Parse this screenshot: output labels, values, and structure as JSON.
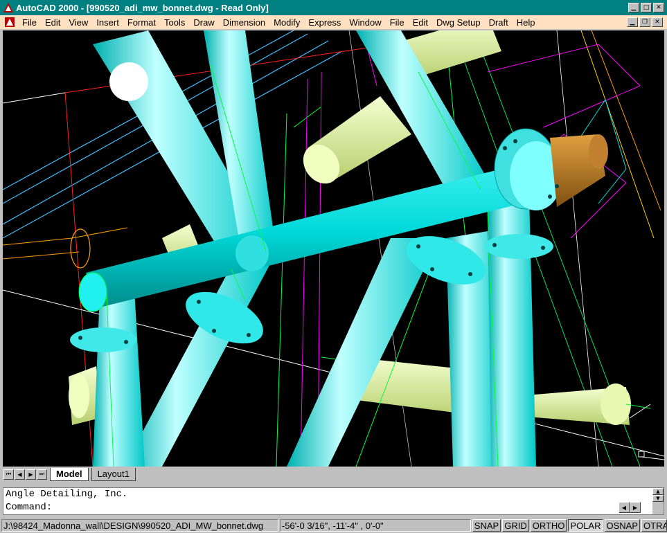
{
  "window": {
    "title": "AutoCAD 2000 - [990520_adi_mw_bonnet.dwg - Read Only]"
  },
  "menu": {
    "items": [
      "File",
      "Edit",
      "View",
      "Insert",
      "Format",
      "Tools",
      "Draw",
      "Dimension",
      "Modify",
      "Express",
      "Window",
      "File",
      "Edit",
      "Dwg Setup",
      "Draft",
      "Help"
    ]
  },
  "tabs": {
    "model": "Model",
    "layout1": "Layout1"
  },
  "command": {
    "history": "Angle Detailing, Inc.",
    "prompt": "Command:"
  },
  "status": {
    "path": "J:\\98424_Madonna_wall\\DESIGN\\990520_ADI_MW_bonnet.dwg",
    "coords": "-56'-0 3/16\", -11'-4\"   , 0'-0\"",
    "toggles": [
      "SNAP",
      "GRID",
      "ORTHO",
      "POLAR",
      "OSNAP",
      "OTRACK"
    ],
    "toggles_on": [
      "POLAR"
    ]
  },
  "icons": {
    "app": "autocad-icon",
    "doc": "drawing-doc-icon"
  },
  "colors": {
    "titlebar": "#008080",
    "menubar": "#ffe0c0",
    "viewport_bg": "#000000",
    "pipe": "#00e0e0",
    "brace": "#e0f0a0",
    "fitting": "#c08020"
  }
}
